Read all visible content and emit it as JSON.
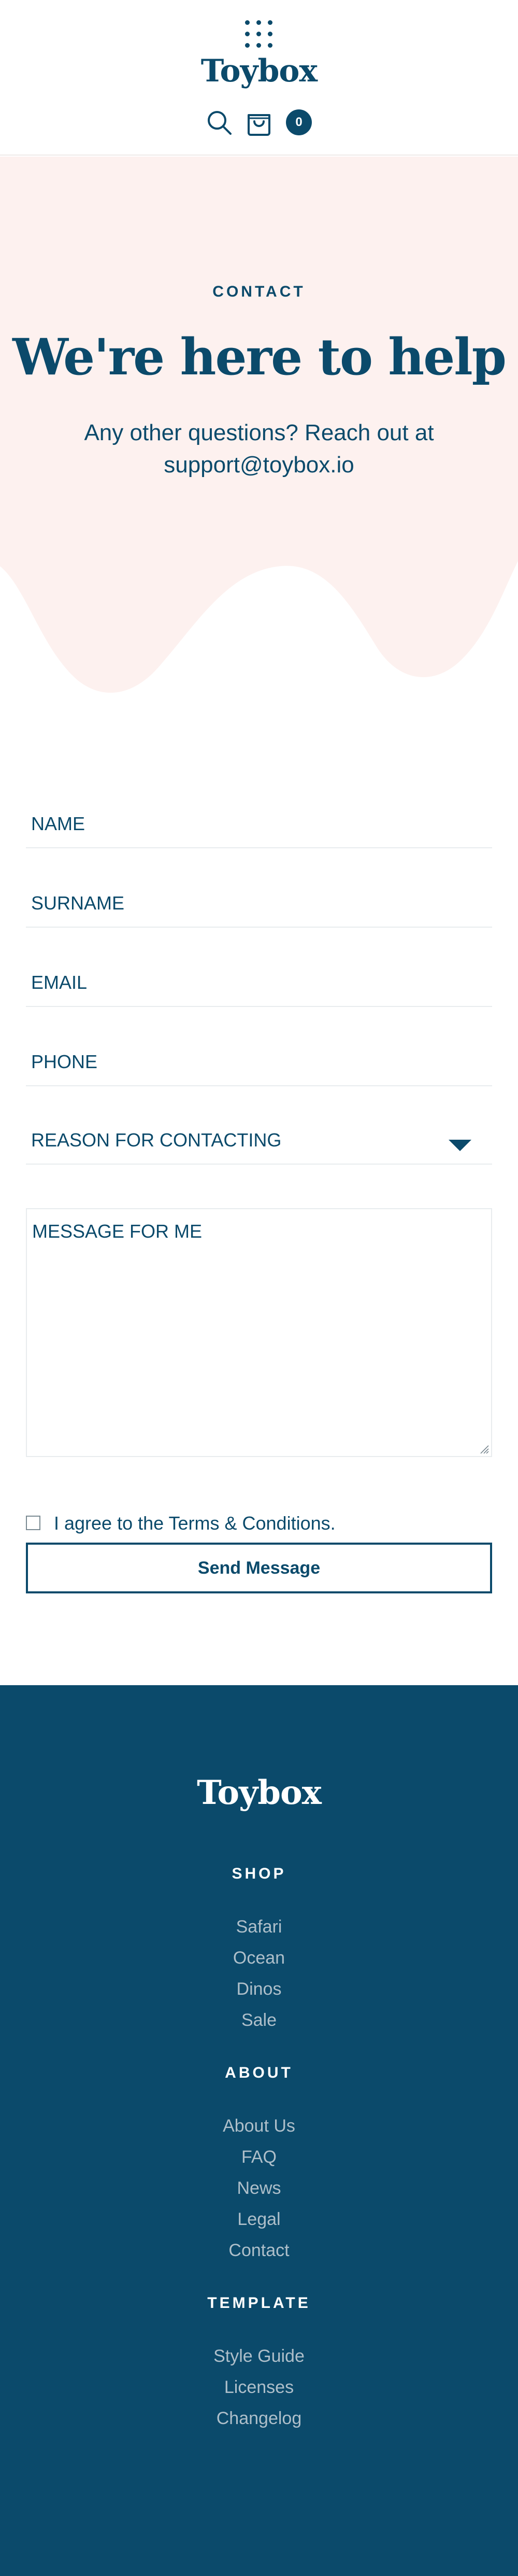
{
  "header": {
    "logo": "Toybox",
    "menu_icon": "grid-dots-icon",
    "search_icon": "search-icon",
    "cart_icon": "shopping-bag-icon",
    "cart_count": "0"
  },
  "hero": {
    "eyebrow": "CONTACT",
    "title": "We're here to help",
    "subtitle": "Any other questions? Reach out at support@toybox.io",
    "background_color": "#fdf1ef"
  },
  "form": {
    "name_label": "NAME",
    "surname_label": "SURNAME",
    "email_label": "EMAIL",
    "phone_label": "PHONE",
    "reason_label": "REASON FOR CONTACTING",
    "message_label": "MESSAGE FOR ME",
    "agree_label": "I agree to the Terms & Conditions.",
    "agree_checked": false,
    "send_label": "Send Message"
  },
  "footer": {
    "logo": "Toybox",
    "background_color": "#0b4a6b",
    "sections": [
      {
        "heading": "SHOP",
        "links": [
          "Safari",
          "Ocean",
          "Dinos",
          "Sale"
        ]
      },
      {
        "heading": "ABOUT",
        "links": [
          "About Us",
          "FAQ",
          "News",
          "Legal",
          "Contact"
        ]
      },
      {
        "heading": "TEMPLATE",
        "links": [
          "Style Guide",
          "Licenses",
          "Changelog"
        ]
      }
    ]
  }
}
